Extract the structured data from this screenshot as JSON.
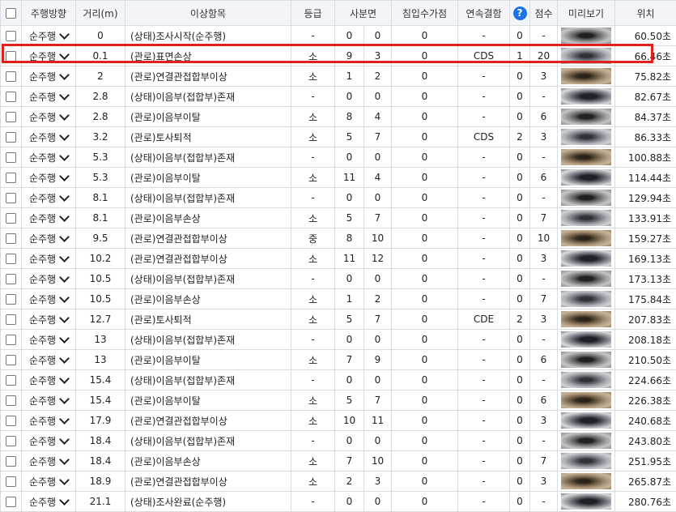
{
  "headers": {
    "select": "",
    "direction": "주행방향",
    "distance": "거리(m)",
    "item": "이상항목",
    "grade": "등급",
    "quadrant": "사분면",
    "infiltration": "침입수가점",
    "continuous": "연속결함",
    "help": "?",
    "score": "점수",
    "preview": "미리보기",
    "position": "위치"
  },
  "highlight_row": 1,
  "rows": [
    {
      "dir": "순주행",
      "dist": "0",
      "item": "(상태)조사시작(순주행)",
      "grade": "-",
      "q1": "0",
      "q2": "0",
      "inf": "0",
      "cont": "-",
      "cnt": "0",
      "score": "-",
      "pos": "60.50초"
    },
    {
      "dir": "순주행",
      "dist": "0.1",
      "item": "(관로)표면손상",
      "grade": "소",
      "q1": "9",
      "q2": "3",
      "inf": "0",
      "cont": "CDS",
      "cnt": "1",
      "score": "20",
      "pos": "66.46초"
    },
    {
      "dir": "순주행",
      "dist": "2",
      "item": "(관로)연결관접합부이상",
      "grade": "소",
      "q1": "1",
      "q2": "2",
      "inf": "0",
      "cont": "-",
      "cnt": "0",
      "score": "3",
      "pos": "75.82초"
    },
    {
      "dir": "순주행",
      "dist": "2.8",
      "item": "(상태)이음부(접합부)존재",
      "grade": "-",
      "q1": "0",
      "q2": "0",
      "inf": "0",
      "cont": "-",
      "cnt": "0",
      "score": "-",
      "pos": "82.67초"
    },
    {
      "dir": "순주행",
      "dist": "2.8",
      "item": "(관로)이음부이탈",
      "grade": "소",
      "q1": "8",
      "q2": "4",
      "inf": "0",
      "cont": "-",
      "cnt": "0",
      "score": "6",
      "pos": "84.37초"
    },
    {
      "dir": "순주행",
      "dist": "3.2",
      "item": "(관로)토사퇴적",
      "grade": "소",
      "q1": "5",
      "q2": "7",
      "inf": "0",
      "cont": "CDS",
      "cnt": "2",
      "score": "3",
      "pos": "86.33초"
    },
    {
      "dir": "순주행",
      "dist": "5.3",
      "item": "(상태)이음부(접합부)존재",
      "grade": "-",
      "q1": "0",
      "q2": "0",
      "inf": "0",
      "cont": "-",
      "cnt": "0",
      "score": "-",
      "pos": "100.88초"
    },
    {
      "dir": "순주행",
      "dist": "5.3",
      "item": "(관로)이음부이탈",
      "grade": "소",
      "q1": "11",
      "q2": "4",
      "inf": "0",
      "cont": "-",
      "cnt": "0",
      "score": "6",
      "pos": "114.44초"
    },
    {
      "dir": "순주행",
      "dist": "8.1",
      "item": "(상태)이음부(접합부)존재",
      "grade": "-",
      "q1": "0",
      "q2": "0",
      "inf": "0",
      "cont": "-",
      "cnt": "0",
      "score": "-",
      "pos": "129.94초"
    },
    {
      "dir": "순주행",
      "dist": "8.1",
      "item": "(관로)이음부손상",
      "grade": "소",
      "q1": "5",
      "q2": "7",
      "inf": "0",
      "cont": "-",
      "cnt": "0",
      "score": "7",
      "pos": "133.91초"
    },
    {
      "dir": "순주행",
      "dist": "9.5",
      "item": "(관로)연결관접합부이상",
      "grade": "중",
      "q1": "8",
      "q2": "10",
      "inf": "0",
      "cont": "-",
      "cnt": "0",
      "score": "10",
      "pos": "159.27초"
    },
    {
      "dir": "순주행",
      "dist": "10.2",
      "item": "(관로)연결관접합부이상",
      "grade": "소",
      "q1": "11",
      "q2": "12",
      "inf": "0",
      "cont": "-",
      "cnt": "0",
      "score": "3",
      "pos": "169.13초"
    },
    {
      "dir": "순주행",
      "dist": "10.5",
      "item": "(상태)이음부(접합부)존재",
      "grade": "-",
      "q1": "0",
      "q2": "0",
      "inf": "0",
      "cont": "-",
      "cnt": "0",
      "score": "-",
      "pos": "173.13초"
    },
    {
      "dir": "순주행",
      "dist": "10.5",
      "item": "(관로)이음부손상",
      "grade": "소",
      "q1": "1",
      "q2": "2",
      "inf": "0",
      "cont": "-",
      "cnt": "0",
      "score": "7",
      "pos": "175.84초"
    },
    {
      "dir": "순주행",
      "dist": "12.7",
      "item": "(관로)토사퇴적",
      "grade": "소",
      "q1": "5",
      "q2": "7",
      "inf": "0",
      "cont": "CDE",
      "cnt": "2",
      "score": "3",
      "pos": "207.83초"
    },
    {
      "dir": "순주행",
      "dist": "13",
      "item": "(상태)이음부(접합부)존재",
      "grade": "-",
      "q1": "0",
      "q2": "0",
      "inf": "0",
      "cont": "-",
      "cnt": "0",
      "score": "-",
      "pos": "208.18초"
    },
    {
      "dir": "순주행",
      "dist": "13",
      "item": "(관로)이음부이탈",
      "grade": "소",
      "q1": "7",
      "q2": "9",
      "inf": "0",
      "cont": "-",
      "cnt": "0",
      "score": "6",
      "pos": "210.50초"
    },
    {
      "dir": "순주행",
      "dist": "15.4",
      "item": "(상태)이음부(접합부)존재",
      "grade": "-",
      "q1": "0",
      "q2": "0",
      "inf": "0",
      "cont": "-",
      "cnt": "0",
      "score": "-",
      "pos": "224.66초"
    },
    {
      "dir": "순주행",
      "dist": "15.4",
      "item": "(관로)이음부이탈",
      "grade": "소",
      "q1": "5",
      "q2": "7",
      "inf": "0",
      "cont": "-",
      "cnt": "0",
      "score": "6",
      "pos": "226.38초"
    },
    {
      "dir": "순주행",
      "dist": "17.9",
      "item": "(관로)연결관접합부이상",
      "grade": "소",
      "q1": "10",
      "q2": "11",
      "inf": "0",
      "cont": "-",
      "cnt": "0",
      "score": "3",
      "pos": "240.68초"
    },
    {
      "dir": "순주행",
      "dist": "18.4",
      "item": "(상태)이음부(접합부)존재",
      "grade": "-",
      "q1": "0",
      "q2": "0",
      "inf": "0",
      "cont": "-",
      "cnt": "0",
      "score": "-",
      "pos": "243.80초"
    },
    {
      "dir": "순주행",
      "dist": "18.4",
      "item": "(관로)이음부손상",
      "grade": "소",
      "q1": "7",
      "q2": "10",
      "inf": "0",
      "cont": "-",
      "cnt": "0",
      "score": "7",
      "pos": "251.95초"
    },
    {
      "dir": "순주행",
      "dist": "18.9",
      "item": "(관로)연결관접합부이상",
      "grade": "소",
      "q1": "2",
      "q2": "3",
      "inf": "0",
      "cont": "-",
      "cnt": "0",
      "score": "3",
      "pos": "265.87초"
    },
    {
      "dir": "순주행",
      "dist": "21.1",
      "item": "(상태)조사완료(순주행)",
      "grade": "-",
      "q1": "0",
      "q2": "0",
      "inf": "0",
      "cont": "-",
      "cnt": "0",
      "score": "-",
      "pos": "280.76초"
    }
  ]
}
